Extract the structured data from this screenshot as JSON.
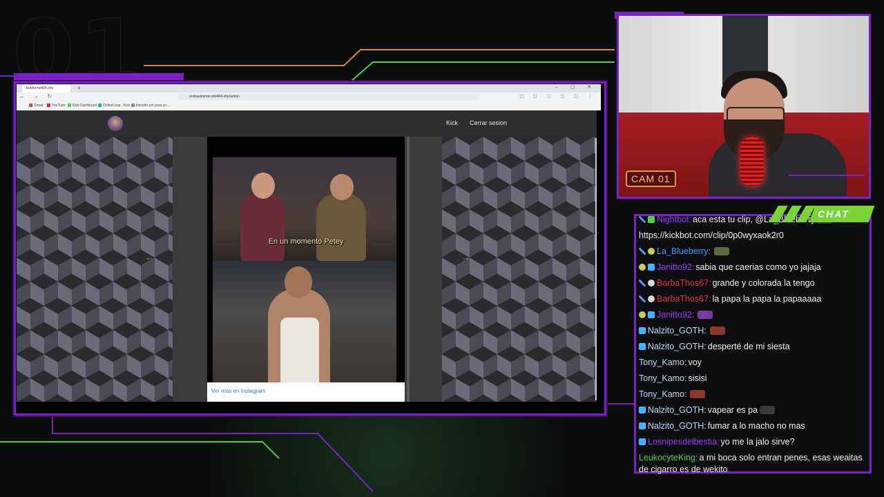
{
  "overlay": {
    "bg_number": "01",
    "cam_label": "CAM 01",
    "chat_badge": "CHAT"
  },
  "browser": {
    "tab_title": "kickforme404.sho",
    "address": "reebautosmecode404.shp/admin",
    "bookmarks": [
      "Gmail",
      "YouTube",
      "Kick Dashboard",
      "OnlineLoop - Kick C...",
      "Intruder por para yo..."
    ]
  },
  "page": {
    "nav_kick": "Kick",
    "nav_logout": "Cerrar sesion",
    "video_caption": "En un momento Petey",
    "instagram_link": "Ver más en Instagram",
    "prev_arrow": "←",
    "next_arrow": "→"
  },
  "chat": {
    "messages": [
      {
        "user": "Nightbot",
        "user_color": "#9a3aff",
        "badges": [
          "sword",
          "check"
        ],
        "text": "aca esta tu clip, @La_Blueberry",
        "emote_color": "#3a3a3a"
      },
      {
        "user": "",
        "user_color": "#f0f0f0",
        "badges": [],
        "text": "https://kickbot.com/clip/0p0wyxaok2r0",
        "emote_color": ""
      },
      {
        "user": "La_Blueberry",
        "user_color": "#3aa0ff",
        "badges": [
          "sword",
          "coin"
        ],
        "text": "",
        "emote_color": "#5a6a3a"
      },
      {
        "user": "Janitto92",
        "user_color": "#9a3aff",
        "badges": [
          "coin",
          "cube"
        ],
        "text": "sabia que caerias como yo jajaja",
        "emote_color": ""
      },
      {
        "user": "BarbaThos67",
        "user_color": "#e2334a",
        "badges": [
          "sword",
          "skull"
        ],
        "text": "grande y colorada la tengo",
        "emote_color": ""
      },
      {
        "user": "BarbaThos67",
        "user_color": "#e2334a",
        "badges": [
          "sword",
          "skull"
        ],
        "text": "la papa la papa la papaaaaa",
        "emote_color": ""
      },
      {
        "user": "Janitto92",
        "user_color": "#9a3aff",
        "badges": [
          "coin",
          "cube"
        ],
        "text": "",
        "emote_color": "#7a3aa0"
      },
      {
        "user": "Nalzito_GOTH",
        "user_color": "#b8dcff",
        "badges": [
          "cube"
        ],
        "text": "",
        "emote_color": "#8a3a2a"
      },
      {
        "user": "Nalzito_GOTH",
        "user_color": "#b8dcff",
        "badges": [
          "cube"
        ],
        "text": "desperté de mi siesta",
        "emote_color": ""
      },
      {
        "user": "Tony_Kamo",
        "user_color": "#b8dcff",
        "badges": [],
        "text": "voy",
        "emote_color": ""
      },
      {
        "user": "Tony_Kamo",
        "user_color": "#b8dcff",
        "badges": [],
        "text": "sisisi",
        "emote_color": ""
      },
      {
        "user": "Tony_Kamo",
        "user_color": "#b8dcff",
        "badges": [],
        "text": "",
        "emote_color": "#8a3a2a"
      },
      {
        "user": "Nalzito_GOTH",
        "user_color": "#b8dcff",
        "badges": [
          "cube"
        ],
        "text": "vapear es pa",
        "emote_color": "#3a3a3a"
      },
      {
        "user": "Nalzito_GOTH",
        "user_color": "#b8dcff",
        "badges": [
          "cube"
        ],
        "text": "fumar a lo macho no mas",
        "emote_color": ""
      },
      {
        "user": "Losnipesdelbestia",
        "user_color": "#9a3aff",
        "badges": [
          "cube"
        ],
        "text": "yo me la jalo sirve?",
        "emote_color": ""
      },
      {
        "user": "LeukocyteKing",
        "user_color": "#52d04c",
        "badges": [],
        "text": "a mi boca solo entran penes, esas weaitas de cigarro es de wekito",
        "emote_color": "",
        "multi": true
      }
    ]
  },
  "colors": {
    "frame_purple": "#7b22c4",
    "chat_green": "#7bd33a",
    "line_orange": "#d98a2a",
    "line_green": "#52d04c"
  }
}
